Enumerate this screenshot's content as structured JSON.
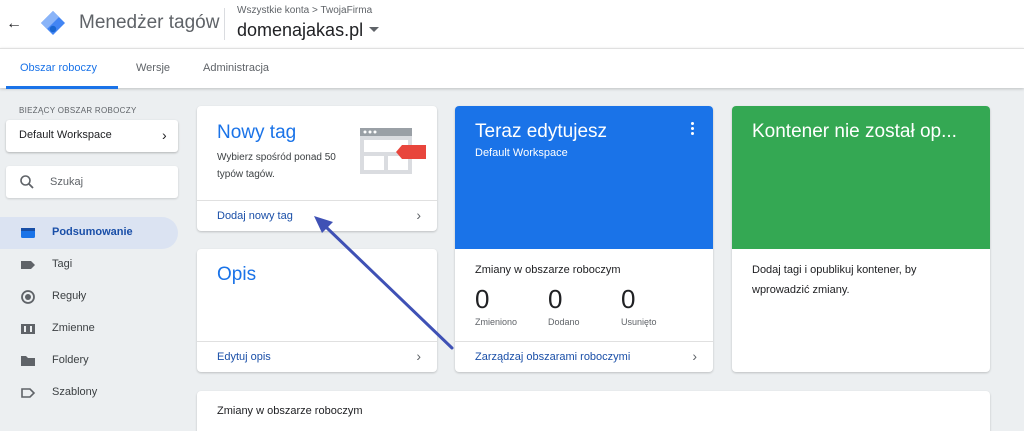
{
  "header": {
    "app_title": "Menedżer tagów",
    "breadcrumb_all": "Wszystkie konta",
    "breadcrumb_account": "TwojaFirma",
    "container_name": "domenajakas.pl"
  },
  "tabs": [
    {
      "label": "Obszar roboczy",
      "active": true
    },
    {
      "label": "Wersje",
      "active": false
    },
    {
      "label": "Administracja",
      "active": false
    }
  ],
  "sidebar": {
    "workspace_heading": "BIEŻĄCY OBSZAR ROBOCZY",
    "workspace_name": "Default Workspace",
    "search_placeholder": "Szukaj",
    "items": [
      {
        "label": "Podsumowanie",
        "icon": "summary-icon",
        "active": true
      },
      {
        "label": "Tagi",
        "icon": "tag-icon",
        "active": false
      },
      {
        "label": "Reguły",
        "icon": "trigger-icon",
        "active": false
      },
      {
        "label": "Zmienne",
        "icon": "variable-icon",
        "active": false
      },
      {
        "label": "Foldery",
        "icon": "folder-icon",
        "active": false
      },
      {
        "label": "Szablony",
        "icon": "template-icon",
        "active": false
      }
    ]
  },
  "new_tag_card": {
    "title": "Nowy tag",
    "description": "Wybierz spośród ponad 50 typów tagów.",
    "link": "Dodaj nowy tag"
  },
  "description_card": {
    "title": "Opis",
    "link": "Edytuj opis"
  },
  "editing_card": {
    "title": "Teraz edytujesz",
    "workspace": "Default Workspace",
    "changes_label": "Zmiany w obszarze roboczym",
    "stats": [
      {
        "value": "0",
        "label": "Zmieniono"
      },
      {
        "value": "0",
        "label": "Dodano"
      },
      {
        "value": "0",
        "label": "Usunięto"
      }
    ],
    "link": "Zarządzaj obszarami roboczymi"
  },
  "container_card": {
    "title": "Kontener nie został op...",
    "description": "Dodaj tagi i opublikuj kontener, by wprowadzić zmiany."
  },
  "bottom_card": {
    "title": "Zmiany w obszarze roboczym"
  },
  "colors": {
    "accent_blue": "#1a73e8",
    "green": "#34a853",
    "annotation_arrow": "#3f51b5",
    "illustration_red": "#e8453c"
  }
}
